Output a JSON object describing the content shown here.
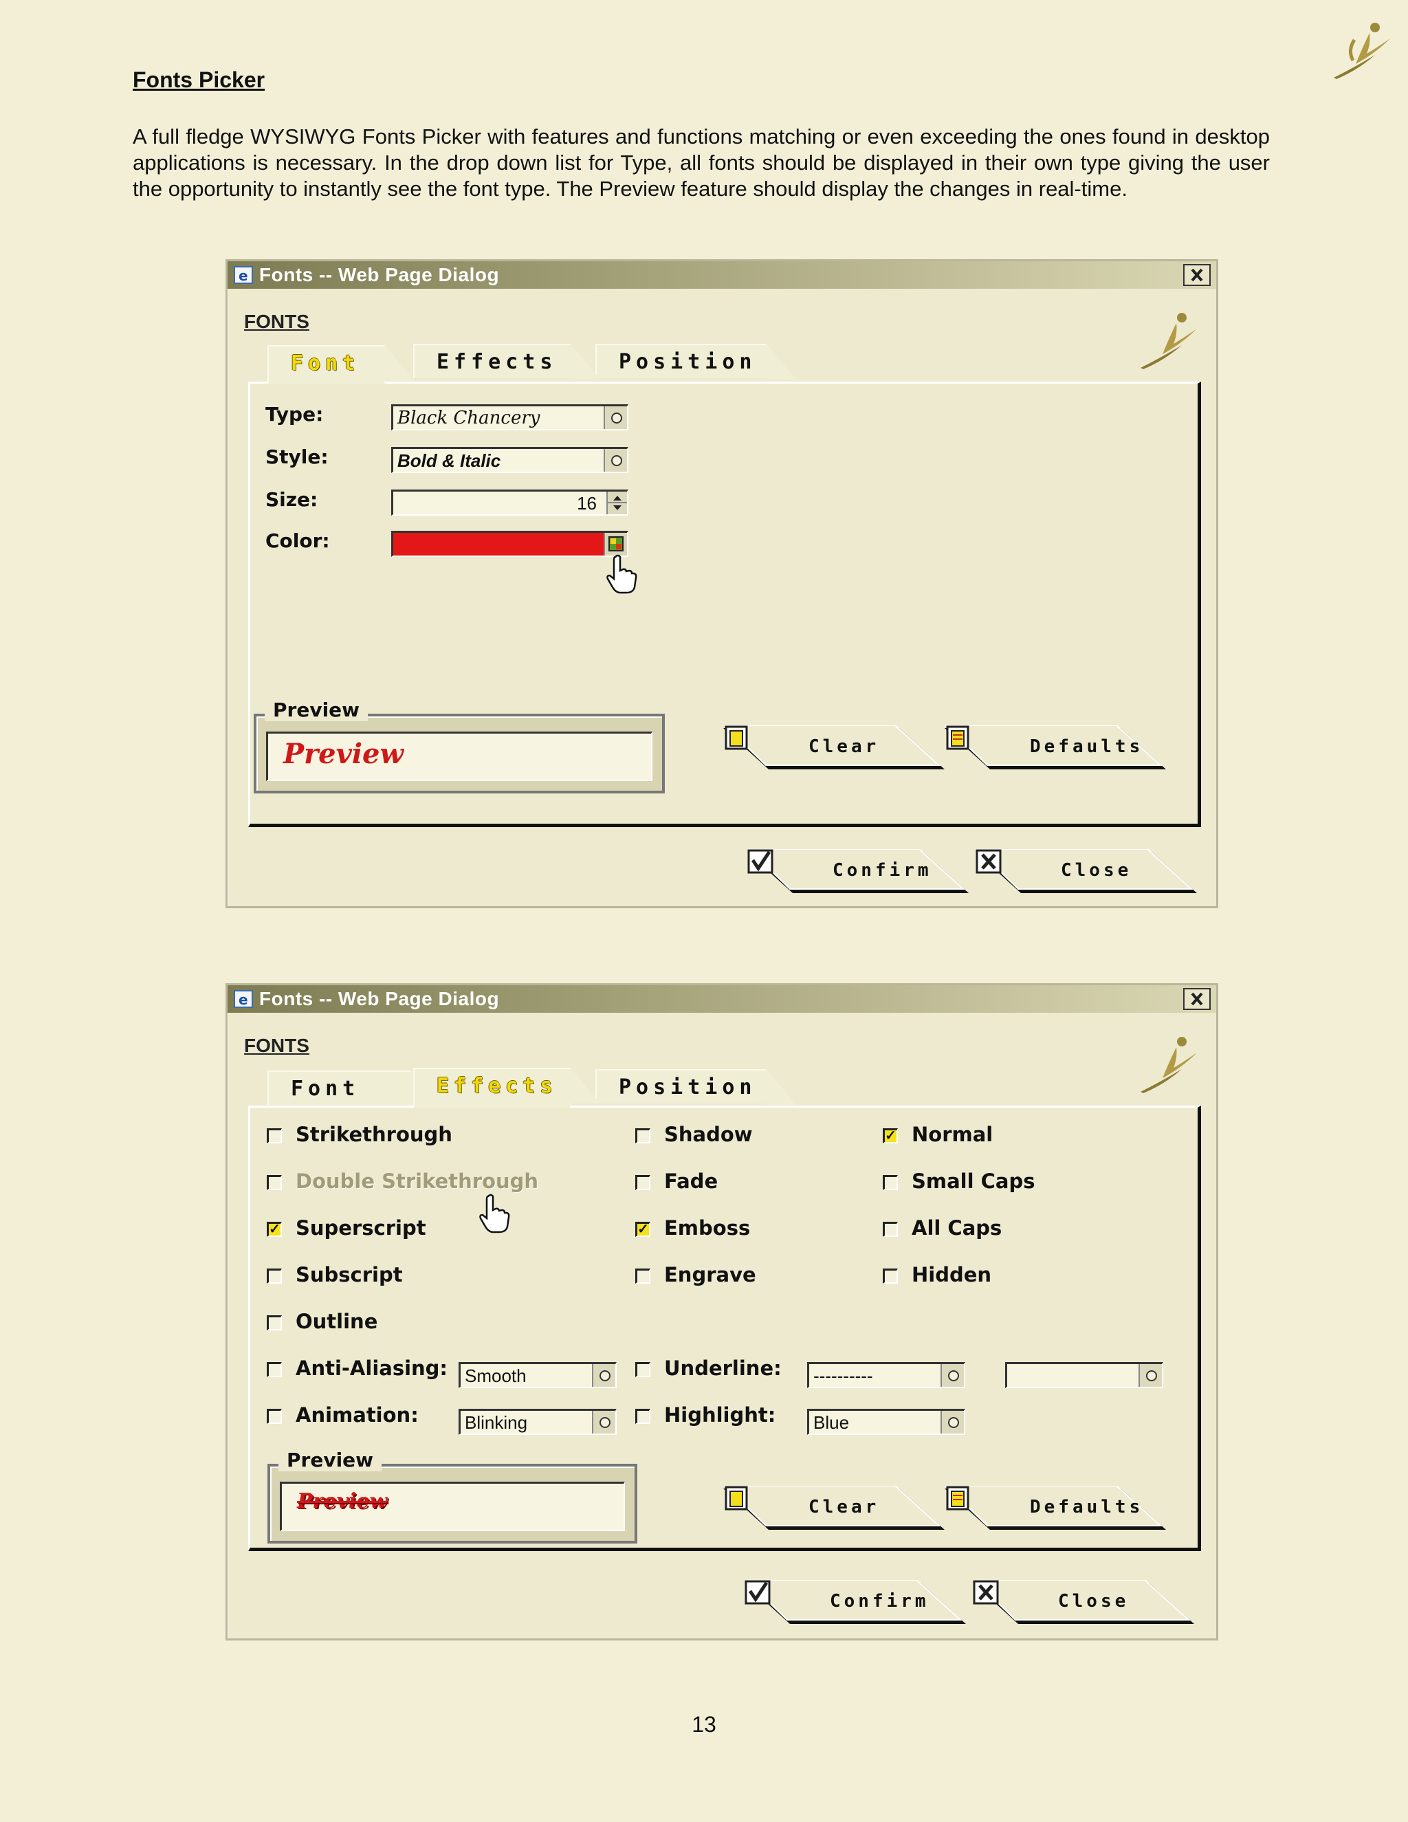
{
  "document": {
    "title": "Fonts Picker",
    "paragraph": "A full fledge WYSIWYG Fonts Picker with features and functions matching or even exceeding the ones found in desktop applications is necessary.  In the drop down list for Type, all fonts should be displayed in their own type giving the user the opportunity to instantly see the font type.  The Preview feature should display the changes in real-time.",
    "page_number": "13"
  },
  "dialog_title": "Fonts -- Web Page Dialog",
  "dialog_heading": "FONTS",
  "tabs": {
    "font": "Font",
    "effects": "Effects",
    "position": "Position"
  },
  "buttons": {
    "clear": "Clear",
    "defaults": "Defaults",
    "confirm": "Confirm",
    "close": "Close"
  },
  "preview": {
    "legend": "Preview",
    "text": "Preview"
  },
  "font_tab": {
    "type_label": "Type:",
    "type_value": "Black Chancery",
    "style_label": "Style:",
    "style_value": "Bold & Italic",
    "size_label": "Size:",
    "size_value": "16",
    "color_label": "Color:",
    "color_value": "#e31717"
  },
  "effects_tab": {
    "col1": [
      {
        "label": "Strikethrough",
        "checked": false
      },
      {
        "label": "Double Strikethrough",
        "checked": false,
        "disabled": true
      },
      {
        "label": "Superscript",
        "checked": true
      },
      {
        "label": "Subscript",
        "checked": false
      },
      {
        "label": "Outline",
        "checked": false
      }
    ],
    "col2": [
      {
        "label": "Shadow",
        "checked": false
      },
      {
        "label": "Fade",
        "checked": false
      },
      {
        "label": "Emboss",
        "checked": true
      },
      {
        "label": "Engrave",
        "checked": false
      }
    ],
    "col3": [
      {
        "label": "Normal",
        "checked": true
      },
      {
        "label": "Small Caps",
        "checked": false
      },
      {
        "label": "All Caps",
        "checked": false
      },
      {
        "label": "Hidden",
        "checked": false
      }
    ],
    "anti_aliasing_label": "Anti-Aliasing:",
    "anti_aliasing_value": "Smooth",
    "animation_label": "Animation:",
    "animation_value": "Blinking",
    "underline_label": "Underline:",
    "underline_value": "----------",
    "underline_color_value": "",
    "highlight_label": "Highlight:",
    "highlight_value": "Blue"
  },
  "colors": {
    "page_bg": "#f2efd6",
    "dialog_bg": "#eeead0",
    "active_tab_text": "#f1d90d",
    "preview_red": "#d01818"
  }
}
